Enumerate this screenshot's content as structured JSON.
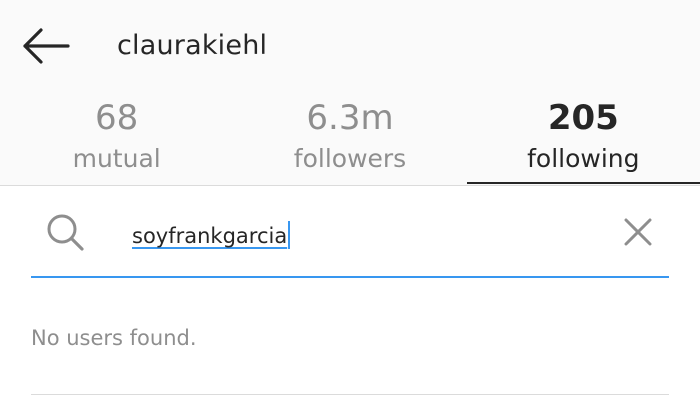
{
  "header": {
    "username": "claurakiehl",
    "back_icon": "arrow-left-icon"
  },
  "tabs": [
    {
      "count": "68",
      "label": "mutual",
      "active": false
    },
    {
      "count": "6.3m",
      "label": "followers",
      "active": false
    },
    {
      "count": "205",
      "label": "following",
      "active": true
    }
  ],
  "search": {
    "value": "soyfrankgarcia",
    "search_icon": "search-icon",
    "clear_icon": "close-icon",
    "accent_color": "#3897f0"
  },
  "results": {
    "empty_message": "No users found."
  }
}
